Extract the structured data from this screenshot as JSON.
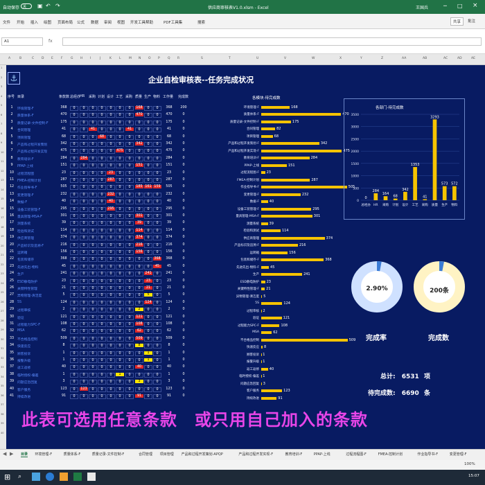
{
  "window": {
    "autosave": "自动保存",
    "toggle": "关",
    "title": "供应商审核表V1.0.xlsm - Excel",
    "user": "王国兵",
    "share": "共享",
    "comment": "批注"
  },
  "ribbon_tabs": [
    "文件",
    "开始",
    "插入",
    "绘图",
    "页面布局",
    "公式",
    "数据",
    "审阅",
    "视图",
    "开发工具",
    "帮助",
    "PDF工具集",
    "搜索"
  ],
  "namebox": "A1",
  "col_headers": [
    "A",
    "B",
    "C",
    "D",
    "E",
    "F",
    "G",
    "H",
    "I",
    "J",
    "K",
    "L",
    "M",
    "N",
    "O",
    "P",
    "Q",
    "R",
    "S",
    "T",
    "U",
    "V",
    "W",
    "X",
    "Y",
    "Z",
    "AA",
    "AB",
    "AC",
    "AD",
    "AE",
    "AF"
  ],
  "sheet": {
    "title": "企业自检审核表--任务完成状况",
    "table_headers": [
      "序号",
      "目录",
      "条款数",
      "总经办",
      "HR",
      "采购",
      "计划",
      "设计",
      "工艺",
      "采购",
      "质量",
      "生产",
      "物料",
      "工作量",
      "完成数"
    ],
    "rows": [
      [
        "1",
        "环境管理-F",
        "368",
        "0",
        "0",
        "0",
        "0",
        "0",
        "0",
        "0",
        "168",
        "0",
        "0",
        "368",
        "200"
      ],
      [
        "2",
        "质量体系-F",
        "470",
        "0",
        "0",
        "0",
        "0",
        "0",
        "0",
        "0",
        "470",
        "0",
        "0",
        "470",
        "0"
      ],
      [
        "3",
        "质量记录-文件控制-F",
        "175",
        "0",
        "0",
        "0",
        "0",
        "0",
        "0",
        "0",
        "0",
        "0",
        "0",
        "175",
        "0"
      ],
      [
        "4",
        "合同管理",
        "41",
        "0",
        "0",
        "41",
        "0",
        "0",
        "0",
        "41",
        "0",
        "0",
        "0",
        "41",
        "0"
      ],
      [
        "5",
        "项目管理",
        "68",
        "0",
        "0",
        "0",
        "68",
        "0",
        "0",
        "0",
        "0",
        "0",
        "0",
        "68",
        "0"
      ],
      [
        "6",
        "产品和过程开发策划",
        "342",
        "0",
        "0",
        "0",
        "0",
        "0",
        "0",
        "0",
        "342",
        "0",
        "0",
        "342",
        "0"
      ],
      [
        "7",
        "产品和过程开发实现",
        "475",
        "0",
        "0",
        "0",
        "0",
        "0",
        "475",
        "0",
        "0",
        "0",
        "0",
        "475",
        "0"
      ],
      [
        "8",
        "教育培训-F",
        "284",
        "0",
        "284",
        "0",
        "0",
        "0",
        "0",
        "0",
        "0",
        "0",
        "0",
        "284",
        "0"
      ],
      [
        "9",
        "PPAP-上线",
        "151",
        "0",
        "0",
        "0",
        "0",
        "0",
        "0",
        "0",
        "151",
        "0",
        "0",
        "151",
        "0"
      ],
      [
        "10",
        "过程流程图",
        "23",
        "0",
        "0",
        "0",
        "0",
        "23",
        "0",
        "0",
        "0",
        "0",
        "0",
        "23",
        "0"
      ],
      [
        "11",
        "FMEA-控制计划",
        "287",
        "0",
        "0",
        "0",
        "0",
        "287",
        "0",
        "0",
        "0",
        "0",
        "0",
        "287",
        "0"
      ],
      [
        "12",
        "作业指导书-F",
        "505",
        "0",
        "0",
        "0",
        "0",
        "0",
        "0",
        "0",
        "185",
        "161",
        "159",
        "505",
        "0"
      ],
      [
        "13",
        "变更管理-F",
        "232",
        "0",
        "0",
        "0",
        "0",
        "232",
        "0",
        "0",
        "0",
        "0",
        "0",
        "232",
        "0"
      ],
      [
        "14",
        "数据-F",
        "40",
        "0",
        "0",
        "0",
        "0",
        "40",
        "0",
        "0",
        "0",
        "0",
        "0",
        "40",
        "0"
      ],
      [
        "15",
        "设备工装管理-F",
        "295",
        "0",
        "0",
        "0",
        "0",
        "295",
        "0",
        "0",
        "0",
        "0",
        "0",
        "295",
        "0"
      ],
      [
        "16",
        "量具管理-MSA-F",
        "301",
        "0",
        "0",
        "0",
        "0",
        "0",
        "0",
        "0",
        "301",
        "0",
        "0",
        "301",
        "0"
      ],
      [
        "17",
        "测量系统",
        "39",
        "0",
        "0",
        "0",
        "0",
        "0",
        "0",
        "0",
        "39",
        "0",
        "0",
        "39",
        "0"
      ],
      [
        "18",
        "检验和测试",
        "114",
        "0",
        "0",
        "0",
        "0",
        "0",
        "0",
        "0",
        "114",
        "0",
        "0",
        "114",
        "0"
      ],
      [
        "19",
        "供应商管理",
        "374",
        "0",
        "0",
        "0",
        "0",
        "0",
        "0",
        "0",
        "374",
        "0",
        "0",
        "374",
        "0"
      ],
      [
        "20",
        "产品标识及追溯-F",
        "216",
        "0",
        "0",
        "0",
        "0",
        "0",
        "0",
        "0",
        "216",
        "0",
        "0",
        "216",
        "0"
      ],
      [
        "21",
        "运转箱",
        "156",
        "0",
        "0",
        "0",
        "0",
        "0",
        "0",
        "0",
        "156",
        "0",
        "0",
        "156",
        "0"
      ],
      [
        "22",
        "包装和储存",
        "368",
        "0",
        "0",
        "0",
        "0",
        "0",
        "0",
        "0",
        "0",
        "0",
        "368",
        "368",
        "0"
      ],
      [
        "23",
        "先进先出-物料",
        "45",
        "0",
        "0",
        "0",
        "0",
        "0",
        "0",
        "0",
        "0",
        "0",
        "45",
        "45",
        "0"
      ],
      [
        "24",
        "生产",
        "241",
        "0",
        "0",
        "0",
        "0",
        "0",
        "0",
        "0",
        "0",
        "241",
        "0",
        "241",
        "0"
      ],
      [
        "25",
        "ESD静电防护",
        "23",
        "0",
        "0",
        "0",
        "0",
        "0",
        "0",
        "0",
        "0",
        "23",
        "0",
        "23",
        "0"
      ],
      [
        "26",
        "关键特性管理",
        "21",
        "0",
        "0",
        "0",
        "0",
        "0",
        "0",
        "0",
        "0",
        "21",
        "0",
        "21",
        "0"
      ],
      [
        "27",
        "异物管理-清洁度",
        "5",
        "0",
        "0",
        "0",
        "0",
        "0",
        "0",
        "0",
        "0",
        "5",
        "0",
        "5",
        "0"
      ],
      [
        "28",
        "5S",
        "124",
        "0",
        "0",
        "0",
        "0",
        "0",
        "0",
        "0",
        "0",
        "124",
        "0",
        "124",
        "0"
      ],
      [
        "29",
        "过程审核",
        "2",
        "0",
        "0",
        "0",
        "0",
        "0",
        "0",
        "0",
        "2",
        "0",
        "0",
        "2",
        "0"
      ],
      [
        "30",
        "验证",
        "121",
        "0",
        "0",
        "0",
        "0",
        "0",
        "0",
        "0",
        "121",
        "0",
        "0",
        "121",
        "0"
      ],
      [
        "31",
        "过程能力SPC-F",
        "108",
        "0",
        "0",
        "0",
        "0",
        "0",
        "0",
        "0",
        "108",
        "0",
        "0",
        "108",
        "0"
      ],
      [
        "32",
        "MSA",
        "62",
        "0",
        "0",
        "0",
        "0",
        "0",
        "0",
        "0",
        "62",
        "0",
        "0",
        "62",
        "0"
      ],
      [
        "33",
        "不合格品控制",
        "509",
        "0",
        "0",
        "0",
        "0",
        "0",
        "0",
        "0",
        "509",
        "0",
        "0",
        "509",
        "0"
      ],
      [
        "34",
        "快速反应",
        "8",
        "0",
        "0",
        "0",
        "0",
        "0",
        "0",
        "0",
        "8",
        "0",
        "0",
        "8",
        "0"
      ],
      [
        "35",
        "顾客投诉",
        "1",
        "0",
        "0",
        "0",
        "0",
        "0",
        "0",
        "0",
        "0",
        "1",
        "0",
        "1",
        "0"
      ],
      [
        "36",
        "报警升级",
        "1",
        "0",
        "0",
        "0",
        "0",
        "0",
        "0",
        "0",
        "0",
        "1",
        "0",
        "1",
        "0"
      ],
      [
        "37",
        "返工返修",
        "40",
        "0",
        "0",
        "0",
        "0",
        "0",
        "0",
        "0",
        "40",
        "0",
        "0",
        "40",
        "0"
      ],
      [
        "38",
        "临时授权-偏差",
        "1",
        "0",
        "0",
        "0",
        "0",
        "0",
        "1",
        "0",
        "0",
        "0",
        "0",
        "1",
        "0"
      ],
      [
        "39",
        "问题应急回复",
        "3",
        "0",
        "0",
        "0",
        "0",
        "0",
        "0",
        "0",
        "3",
        "0",
        "0",
        "3",
        "0"
      ],
      [
        "40",
        "客户服务",
        "123",
        "0",
        "123",
        "0",
        "0",
        "0",
        "0",
        "0",
        "0",
        "0",
        "0",
        "123",
        "0"
      ],
      [
        "41",
        "持续改进",
        "91",
        "0",
        "0",
        "0",
        "0",
        "0",
        "0",
        "0",
        "91",
        "0",
        "0",
        "91",
        "0"
      ]
    ],
    "hchart_title": "各模块-待完成数",
    "hbars": [
      [
        "环境管理-F",
        168
      ],
      [
        "质量体系-F",
        470
      ],
      [
        "质量记录-文件控制-F",
        175
      ],
      [
        "合同管理",
        82
      ],
      [
        "项目管理",
        68
      ],
      [
        "产品和过程开发策划-F",
        342
      ],
      [
        "产品和过程开发实现-F",
        475
      ],
      [
        "教育培训-F",
        284
      ],
      [
        "PPAP-上线",
        151
      ],
      [
        "过程流程图-F",
        23
      ],
      [
        "FMEA-控制计划",
        287
      ],
      [
        "作业指导书-F",
        505
      ],
      [
        "变更管理-F",
        232
      ],
      [
        "数据-F",
        40
      ],
      [
        "设备工装管理-F",
        295
      ],
      [
        "量具管理-MSA-F",
        301
      ],
      [
        "测量系统",
        39
      ],
      [
        "检验和测试",
        114
      ],
      [
        "供应商管理",
        374
      ],
      [
        "产品标识及追溯-F",
        216
      ],
      [
        "运转箱",
        156
      ],
      [
        "包装和储存-F",
        368
      ],
      [
        "先进先出-物料-F",
        45
      ],
      [
        "生产",
        241
      ],
      [
        "ESD静电防护",
        23
      ],
      [
        "关键特性管理-F",
        21
      ],
      [
        "异物管理-清洁度",
        5
      ],
      [
        "5S",
        124
      ],
      [
        "过程审核",
        2
      ],
      [
        "验证",
        121
      ],
      [
        "过程能力SPC-F",
        108
      ],
      [
        "MSA",
        62
      ],
      [
        "不合格品控制",
        509
      ],
      [
        "快速反应",
        8
      ],
      [
        "顾客投诉",
        1
      ],
      [
        "报警升级",
        1
      ],
      [
        "返工返修",
        40
      ],
      [
        "临时授权-偏差",
        1
      ],
      [
        "问题应急回复",
        3
      ],
      [
        "客户服务",
        123
      ],
      [
        "持续改进",
        91
      ]
    ],
    "vchart_title": "各部门-待完成数",
    "vchart_yticks": [
      "0",
      "500",
      "1000",
      "1500",
      "2000",
      "2500",
      "3000",
      "3500"
    ],
    "vbars": [
      [
        "总经办",
        0
      ],
      [
        "HR",
        284
      ],
      [
        "采购",
        164
      ],
      [
        "计划",
        68
      ],
      [
        "设计",
        342
      ],
      [
        "工艺",
        1353
      ],
      [
        "采购",
        41
      ],
      [
        "质量",
        3293
      ],
      [
        "生产",
        573
      ],
      [
        "物料",
        572
      ]
    ],
    "donut1": {
      "value": "2.90%",
      "label": "完成率",
      "fraction": 0.029
    },
    "donut2": {
      "value": "200条",
      "label": "完成数",
      "fraction": 0.03
    },
    "total_label": "总计:",
    "total_value": "6531",
    "total_unit": "项",
    "pending_label": "待完成数:",
    "pending_value": "6690",
    "pending_unit": "条",
    "banner": "此表可选用任意条款　或只用自己加入的条款"
  },
  "sheet_tabs": [
    "目录",
    "环境管理-F",
    "质量体系-F",
    "质量记录-文件控制-F",
    "合同管理",
    "项目管理",
    "产品和过程开发策划-APQP",
    "产品和过程开发实现-F",
    "教育培训-F",
    "PPAP-上线",
    "过程流程图-F",
    "FMEA-控制计划",
    "作业指导书-F",
    "变更管理-F",
    "数..."
  ],
  "status": {
    "zoom": "100%"
  },
  "taskbar": {
    "time": "15:07"
  }
}
